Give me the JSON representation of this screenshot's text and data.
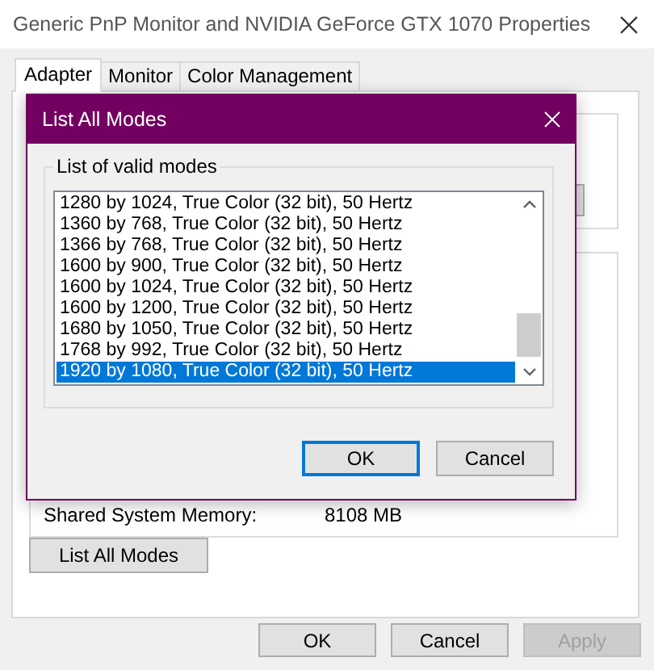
{
  "window": {
    "title": "Generic PnP Monitor and NVIDIA GeForce GTX 1070 Properties"
  },
  "tabs": [
    {
      "label": "Adapter",
      "selected": true
    },
    {
      "label": "Monitor",
      "selected": false
    },
    {
      "label": "Color Management",
      "selected": false
    }
  ],
  "adapter": {
    "info_rows": [
      {
        "label": "Shared System Memory:",
        "value": "8108 MB"
      }
    ],
    "list_button": "List All Modes"
  },
  "buttons": [
    {
      "label": "OK",
      "disabled": false
    },
    {
      "label": "Cancel",
      "disabled": false
    },
    {
      "label": "Apply",
      "disabled": true
    }
  ],
  "dialog": {
    "title": "List All Modes",
    "group_label": "List of valid modes",
    "modes": [
      {
        "label": "1280 by 1024, True Color (32 bit), 50 Hertz",
        "selected": false
      },
      {
        "label": "1360 by 768, True Color (32 bit), 50 Hertz",
        "selected": false
      },
      {
        "label": "1366 by 768, True Color (32 bit), 50 Hertz",
        "selected": false
      },
      {
        "label": "1600 by 900, True Color (32 bit), 50 Hertz",
        "selected": false
      },
      {
        "label": "1600 by 1024, True Color (32 bit), 50 Hertz",
        "selected": false
      },
      {
        "label": "1600 by 1200, True Color (32 bit), 50 Hertz",
        "selected": false
      },
      {
        "label": "1680 by 1050, True Color (32 bit), 50 Hertz",
        "selected": false
      },
      {
        "label": "1768 by 992, True Color (32 bit), 50 Hertz",
        "selected": false
      },
      {
        "label": "1920 by 1080, True Color (32 bit), 50 Hertz",
        "selected": true
      }
    ],
    "buttons": [
      {
        "label": "OK",
        "default": true
      },
      {
        "label": "Cancel",
        "default": false
      }
    ]
  }
}
